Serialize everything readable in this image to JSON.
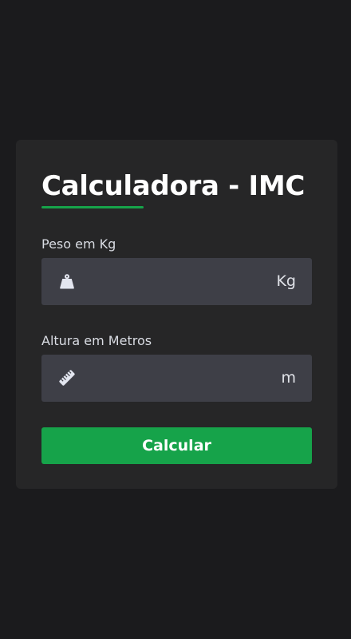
{
  "form": {
    "title": "Calculadora - IMC",
    "weight": {
      "label": "Peso em Kg",
      "value": "",
      "placeholder": "",
      "unit": "Kg",
      "icon": "weight-icon"
    },
    "height": {
      "label": "Altura em Metros",
      "value": "",
      "placeholder": "",
      "unit": "m",
      "icon": "ruler-icon"
    },
    "submit_label": "Calcular"
  },
  "colors": {
    "background": "#1b1b1d",
    "card": "#262627",
    "input": "#3e3f47",
    "accent": "#16a34a",
    "text": "#ffffff",
    "muted_text": "#d9dce3"
  }
}
